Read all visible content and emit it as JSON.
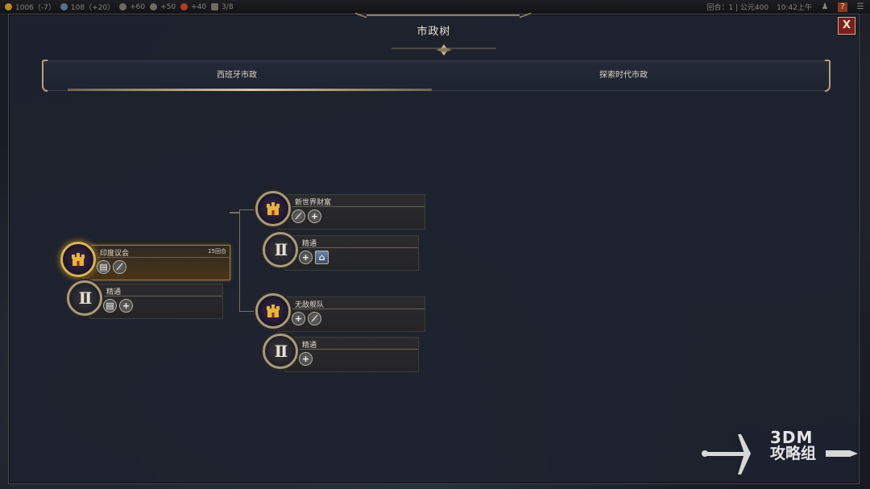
{
  "topbar": {
    "resources": [
      {
        "icon": "gold-icon",
        "text": "1006（-7）",
        "color": "#c9a24a"
      },
      {
        "icon": "science-icon",
        "text": "108（+20）",
        "color": "#8a9cb2"
      },
      {
        "icon": "faith-icon",
        "text": "+60",
        "color": "#9a9488"
      },
      {
        "icon": "culture-icon",
        "text": "+50",
        "color": "#9a9488"
      },
      {
        "icon": "influence-icon",
        "text": "+40",
        "color": "#c0452e"
      },
      {
        "icon": "settlement-icon",
        "text": "3/8",
        "color": "#9a9488"
      }
    ],
    "turn": "回合：1 | 公元400",
    "clock": "10:42上午"
  },
  "window": {
    "title": "市政树",
    "close_label": "X"
  },
  "tabs": [
    {
      "label": "西班牙市政",
      "selected": true
    },
    {
      "label": "探索时代市政",
      "selected": false
    }
  ],
  "tree": {
    "root": {
      "label": "印度议会",
      "turns": "15回合",
      "icons": [
        "building-icon",
        "quill-icon"
      ]
    },
    "root_mastery": {
      "label": "精通",
      "roman": "II",
      "icons": [
        "building-icon",
        "plus-icon"
      ]
    },
    "branch_a": {
      "label": "新世界财富",
      "icons": [
        "quill-icon",
        "plus-icon"
      ]
    },
    "branch_a_mastery": {
      "label": "精通",
      "roman": "II",
      "icons": [
        "plus-icon",
        "tile-icon"
      ]
    },
    "branch_b": {
      "label": "无敌舰队",
      "icons": [
        "plus-icon",
        "quill-icon"
      ]
    },
    "branch_b_mastery": {
      "label": "精通",
      "roman": "II",
      "icons": [
        "plus-icon"
      ]
    }
  },
  "watermark": {
    "line1": "3DM",
    "line2": "攻略组"
  }
}
